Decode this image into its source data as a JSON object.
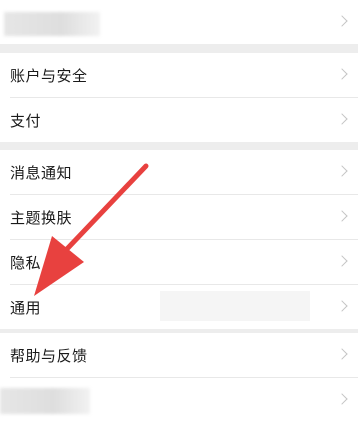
{
  "menu": {
    "account_security": "账户与安全",
    "payment": "支付",
    "notifications": "消息通知",
    "theme": "主题换肤",
    "privacy": "隐私",
    "general": "通用",
    "help_feedback": "帮助与反馈"
  },
  "colors": {
    "background": "#ededed",
    "row": "#ffffff",
    "text": "#1a1a1a",
    "chevron": "#c4c4c4",
    "annotation_arrow": "#e8413f"
  },
  "icons": {
    "row_chevron": "chevron-right-icon",
    "annotation": "red-arrow-annotation"
  }
}
